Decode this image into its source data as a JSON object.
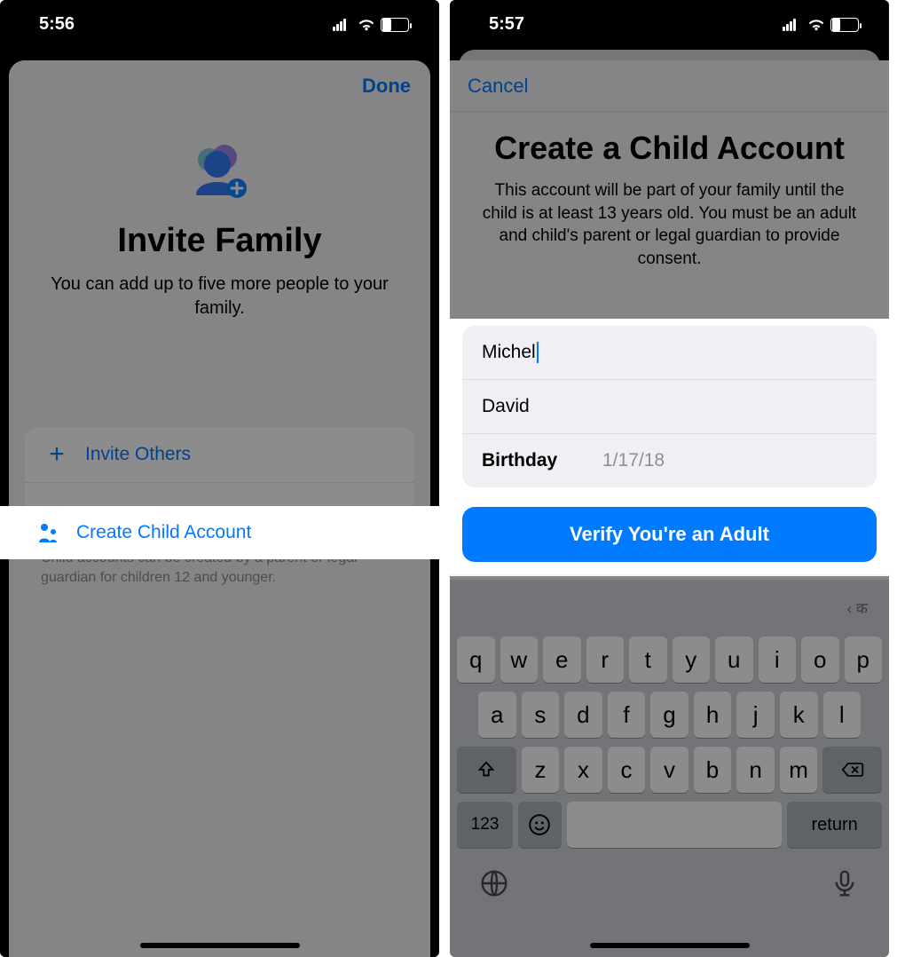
{
  "colors": {
    "accent": "#007aff"
  },
  "phone1": {
    "status": {
      "time": "5:56",
      "battery": "32"
    },
    "header": {
      "done": "Done"
    },
    "title": "Invite Family",
    "subtitle": "You can add up to five more people to your family.",
    "options": {
      "invite_others": "Invite Others",
      "create_child": "Create Child Account"
    },
    "footnote": "Child accounts can be created by a parent or legal guardian for children 12 and younger."
  },
  "phone2": {
    "status": {
      "time": "5:57",
      "battery": "31"
    },
    "header": {
      "cancel": "Cancel"
    },
    "title": "Create a Child Account",
    "subtitle": "This account will be part of your family until the child is at least 13 years old. You must be an adult and child's parent or legal guardian to provide consent.",
    "form": {
      "first_name": "Michel",
      "last_name": "David",
      "birthday_label": "Birthday",
      "birthday_value": "1/17/18"
    },
    "primary_button": "Verify You're an Adult",
    "keyboard": {
      "suggestion_lang": "‹ क",
      "row1": [
        "q",
        "w",
        "e",
        "r",
        "t",
        "y",
        "u",
        "i",
        "o",
        "p"
      ],
      "row2": [
        "a",
        "s",
        "d",
        "f",
        "g",
        "h",
        "j",
        "k",
        "l"
      ],
      "row3": [
        "z",
        "x",
        "c",
        "v",
        "b",
        "n",
        "m"
      ],
      "num_key": "123",
      "return_key": "return"
    }
  }
}
